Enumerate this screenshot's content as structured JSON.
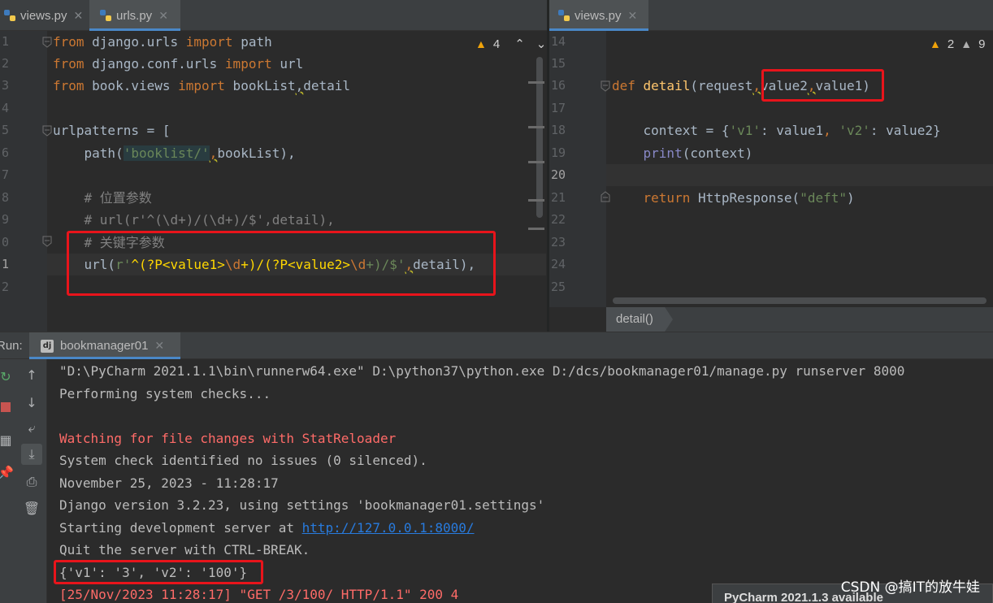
{
  "left_tabs": [
    {
      "label": "views.py",
      "active": false
    },
    {
      "label": "urls.py",
      "active": true
    }
  ],
  "right_tabs": [
    {
      "label": "views.py",
      "active": true
    }
  ],
  "left_editor": {
    "inspections": {
      "warnings": "4"
    },
    "line_numbers": [
      "1",
      "2",
      "3",
      "4",
      "5",
      "6",
      "7",
      "8",
      "9",
      "0",
      "1",
      "2"
    ],
    "current_line_index": 10,
    "lines": [
      {
        "imp1": "from",
        "mod": " django.urls ",
        "imp2": "import",
        "name": " path"
      },
      {
        "imp1": "from",
        "mod": " django.conf.urls ",
        "imp2": "import",
        "name": " url"
      },
      {
        "imp1": "from",
        "mod": " book.views ",
        "imp2": "import",
        "name1": " bookList",
        "comma": ",",
        "name2": "detail"
      }
    ],
    "urlpatterns_line": "urlpatterns = [",
    "path_line": {
      "call": "    path(",
      "str": "'booklist/'",
      "comma": ",",
      "rest": "bookList",
      "tail": "),"
    },
    "comment1": "    # 位置参数",
    "comment2": "    # url(r'^(\\d+)/(\\d+)/$',detail),",
    "comment3": "    # 关键字参数",
    "url_line": {
      "call": "    url(",
      "prefix": "r'",
      "p1": "^(?P<value1>",
      "d1": "\\d",
      "p2": "+)/(",
      "p3": "?P<value2>",
      "d2": "\\d",
      "p4": "+)/$'",
      "comma": ",",
      "rest": "detail",
      "tail": "),"
    }
  },
  "right_editor": {
    "inspections": {
      "warnings": "2",
      "weak": "9"
    },
    "line_numbers": [
      "14",
      "15",
      "16",
      "17",
      "18",
      "19",
      "20",
      "21",
      "22",
      "23",
      "24",
      "25"
    ],
    "current_line_index": 6,
    "def_line": {
      "kw": "def ",
      "fn": "detail",
      "open": "(request",
      "comma": ",",
      "params": "value2",
      "comma2": ",",
      "param2": "value1",
      "close": ")"
    },
    "context_line": {
      "pre": "    context = {",
      "k1": "'v1'",
      "m1": ": value1",
      "c1": ", ",
      "k2": "'v2'",
      "m2": ": value2}"
    },
    "print_line": {
      "pre": "    ",
      "bi": "print",
      "rest": "(context)"
    },
    "return_line": {
      "pre": "    ",
      "kw": "return",
      "mid": " HttpResponse(",
      "str": "\"deft\"",
      "close": ")"
    },
    "breadcrumb": "detail()"
  },
  "run_panel": {
    "label": "Run:",
    "tab_label": "bookmanager01",
    "lines": [
      "\"D:\\PyCharm 2021.1.1\\bin\\runnerw64.exe\" D:\\python37\\python.exe D:/dcs/bookmanager01/manage.py runserver 8000",
      "Performing system checks...",
      "",
      "Watching for file changes with StatReloader",
      "System check identified no issues (0 silenced).",
      "November 25, 2023 - 11:28:17",
      "Django version 3.2.23, using settings 'bookmanager01.settings'",
      "Starting development server at ",
      "Quit the server with CTRL-BREAK.",
      "{'v1': '3', 'v2': '100'}",
      "[25/Nov/2023 11:28:17] \"GET /3/100/ HTTP/1.1\" 200 4"
    ],
    "server_link": "http://127.0.0.1:8000/"
  },
  "notification": "PyCharm 2021.1.3 available",
  "watermark": "CSDN @搞IT的放牛娃",
  "colors": {
    "accent": "#4a88c7",
    "highlight_box": "#e8141b",
    "error_text": "#ff6b68",
    "link": "#287bde"
  }
}
